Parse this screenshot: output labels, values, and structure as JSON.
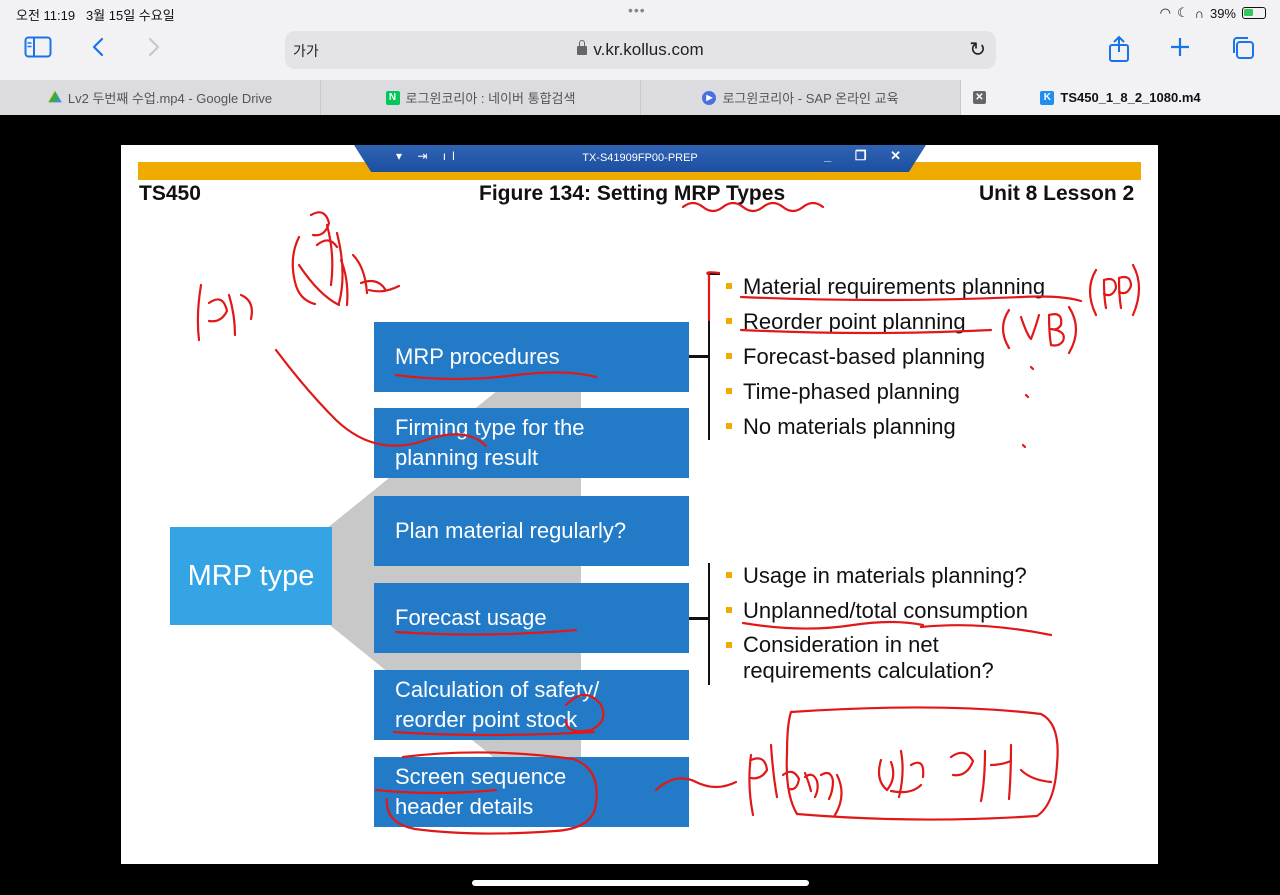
{
  "status_bar": {
    "time": "오전 11:19",
    "date": "3월 15일 수요일",
    "battery": "39%"
  },
  "toolbar": {
    "text_size": "가가",
    "url": "v.kr.kollus.com"
  },
  "tabs": [
    {
      "label": "Lv2 두번째 수업.mp4 - Google Drive",
      "favicon": "google-drive-icon"
    },
    {
      "label": "로그윈코리아 : 네이버 통합검색",
      "favicon": "naver-icon"
    },
    {
      "label": "로그윈코리아 - SAP 온라인 교육",
      "favicon": "play-icon"
    },
    {
      "label": "TS450_1_8_2_1080.m4",
      "favicon": "kollus-icon"
    }
  ],
  "remote_bar": {
    "title": "TX-S41909FP00-PREP"
  },
  "slide": {
    "course": "TS450",
    "figure_title": "Figure 134: Setting MRP Types",
    "unit": "Unit 8 Lesson 2",
    "root": "MRP type",
    "boxes": [
      {
        "text": "MRP procedures"
      },
      {
        "line1": "Firming type for the",
        "line2": "planning result"
      },
      {
        "text": "Plan material regularly?"
      },
      {
        "text": "Forecast usage"
      },
      {
        "line1": "Calculation of safety/",
        "line2": "reorder point stock"
      },
      {
        "line1": "Screen sequence",
        "line2": "header details"
      }
    ],
    "procedures_list": [
      "Material requirements planning",
      "Reorder point planning",
      "Forecast-based planning",
      "Time-phased planning",
      "No materials planning"
    ],
    "forecast_list": {
      "item1": "Usage in materials planning?",
      "item2": "Unplanned/total consumption",
      "item3_line1": "Consideration in net",
      "item3_line2": "requirements calculation?"
    }
  }
}
